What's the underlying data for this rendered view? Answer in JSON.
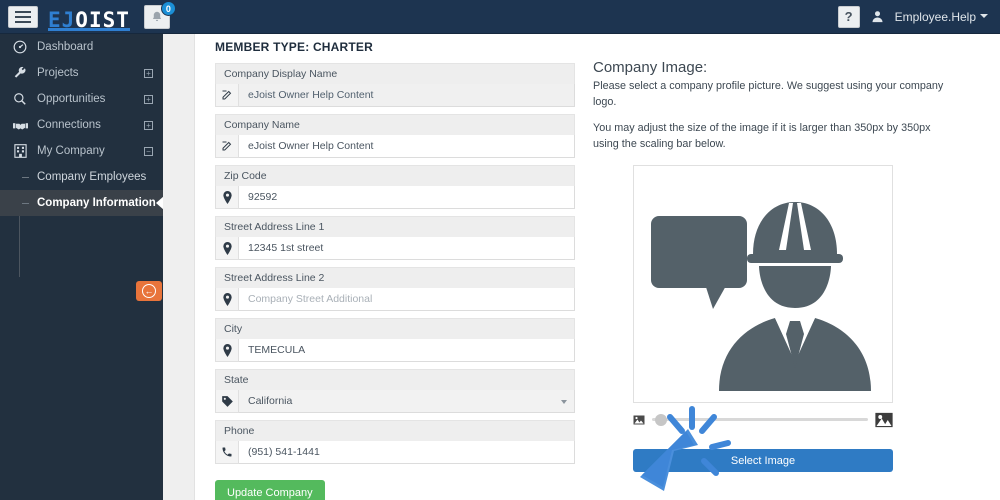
{
  "topbar": {
    "menu_icon": "hamburger-icon",
    "logo_part1": "EJ",
    "logo_part2": "OIST",
    "bell_icon": "bell-icon",
    "notification_count": "0",
    "help_label": "?",
    "user_icon": "user-icon",
    "user_name": "Employee.Help",
    "bg_color": "#1d3450",
    "accent_color": "#2f7fd1"
  },
  "sidebar": {
    "bg_color": "#22303f",
    "active_color": "#3a4149",
    "items": [
      {
        "label": "Dashboard",
        "icon": "gauge-icon",
        "expander": ""
      },
      {
        "label": "Projects",
        "icon": "wrench-icon",
        "expander": "+"
      },
      {
        "label": "Opportunities",
        "icon": "magnifier-icon",
        "expander": "+"
      },
      {
        "label": "Connections",
        "icon": "handshake-icon",
        "expander": "+"
      },
      {
        "label": "My Company",
        "icon": "building-icon",
        "expander": "−"
      }
    ],
    "subitems": [
      {
        "label": "Company Employees",
        "active": false
      },
      {
        "label": "Company Information",
        "active": true
      }
    ],
    "collapse_icon": "arrow-left-circle-icon",
    "collapse_color": "#e8743b"
  },
  "main": {
    "member_type": "MEMBER TYPE: CHARTER",
    "fields": [
      {
        "label": "Company Display Name",
        "value": "eJoist Owner Help Content",
        "placeholder": "",
        "icon": "edit-icon",
        "readonly": true,
        "type": "text"
      },
      {
        "label": "Company Name",
        "value": "eJoist Owner Help Content",
        "placeholder": "",
        "icon": "edit-icon",
        "readonly": false,
        "type": "text"
      },
      {
        "label": "Zip Code",
        "value": "92592",
        "placeholder": "",
        "icon": "pin-icon",
        "readonly": false,
        "type": "text"
      },
      {
        "label": "Street Address Line 1",
        "value": "12345 1st street",
        "placeholder": "",
        "icon": "pin-icon",
        "readonly": false,
        "type": "text"
      },
      {
        "label": "Street Address Line 2",
        "value": "",
        "placeholder": "Company Street Additional",
        "icon": "pin-icon",
        "readonly": false,
        "type": "text"
      },
      {
        "label": "City",
        "value": "TEMECULA",
        "placeholder": "",
        "icon": "pin-icon",
        "readonly": false,
        "type": "text"
      },
      {
        "label": "State",
        "value": "California",
        "placeholder": "",
        "icon": "tag-icon",
        "readonly": false,
        "type": "select"
      },
      {
        "label": "Phone",
        "value": "(951) 541-1441",
        "placeholder": "",
        "icon": "phone-icon",
        "readonly": false,
        "type": "text"
      }
    ],
    "update_button": "Update Company",
    "update_button_color": "#54ba5d"
  },
  "image_panel": {
    "title": "Company Image:",
    "paragraph1": "Please select a company profile picture. We suggest using your company logo.",
    "paragraph2": "You may adjust the size of the image if it is larger than 350px by 350px using the scaling bar below.",
    "preview_icon": "construction-worker-with-speech-bubble-icon",
    "preview_color": "#546169",
    "slider_small_icon": "small-image-icon",
    "slider_large_icon": "large-image-icon",
    "slider_value": "4",
    "select_image_button": "Select Image",
    "select_image_color": "#2f7bc4",
    "cursor_icon": "click-cursor-icon",
    "cursor_color": "#3f86d8"
  }
}
